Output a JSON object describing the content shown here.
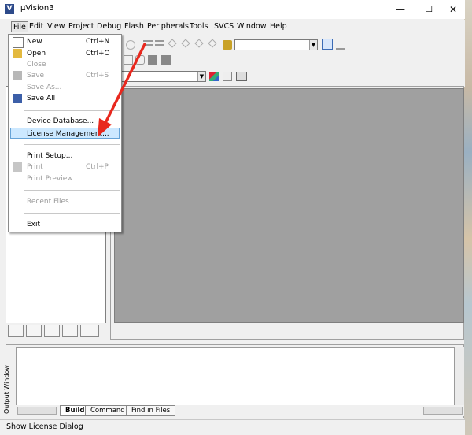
{
  "window": {
    "title": "µVision3",
    "icon": "V",
    "buttons": {
      "minimize": "—",
      "maximize": "☐",
      "close": "✕"
    }
  },
  "menubar": [
    "File",
    "Edit",
    "View",
    "Project",
    "Debug",
    "Flash",
    "Peripherals",
    "Tools",
    "SVCS",
    "Window",
    "Help"
  ],
  "file_menu": {
    "items": [
      {
        "label": "New",
        "shortcut": "Ctrl+N",
        "enabled": true,
        "icon": "new-file-icon"
      },
      {
        "label": "Open",
        "shortcut": "Ctrl+O",
        "enabled": true,
        "icon": "open-folder-icon"
      },
      {
        "label": "Close",
        "shortcut": "",
        "enabled": false
      },
      {
        "label": "Save",
        "shortcut": "Ctrl+S",
        "enabled": false,
        "icon": "save-icon"
      },
      {
        "label": "Save As...",
        "shortcut": "",
        "enabled": false
      },
      {
        "label": "Save All",
        "shortcut": "",
        "enabled": true,
        "icon": "save-all-icon"
      },
      {
        "label": "Device Database...",
        "shortcut": "",
        "enabled": true
      },
      {
        "label": "License Management...",
        "shortcut": "",
        "enabled": true,
        "highlighted": true
      },
      {
        "label": "Print Setup...",
        "shortcut": "",
        "enabled": true
      },
      {
        "label": "Print",
        "shortcut": "Ctrl+P",
        "enabled": false,
        "icon": "print-icon"
      },
      {
        "label": "Print Preview",
        "shortcut": "",
        "enabled": false
      },
      {
        "label": "Recent Files",
        "shortcut": "",
        "enabled": false
      },
      {
        "label": "Exit",
        "shortcut": "",
        "enabled": true
      }
    ]
  },
  "output": {
    "label": "Output Window",
    "tabs": [
      "Build",
      "Command",
      "Find in Files"
    ],
    "active_tab": "Build"
  },
  "status": {
    "text": "Show License Dialog"
  },
  "colors": {
    "highlight": "#cce8ff",
    "editor_bg": "#a0a0a0",
    "arrow": "#e8281e"
  }
}
